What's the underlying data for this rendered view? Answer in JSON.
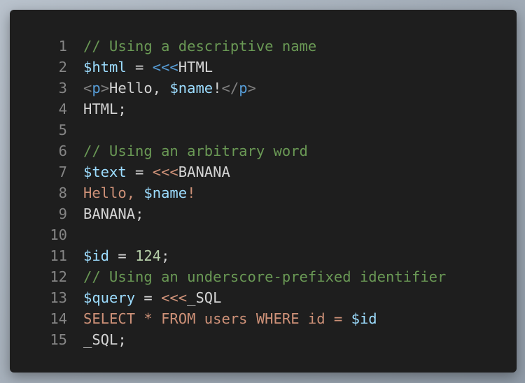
{
  "code": {
    "lines": [
      {
        "number": "1",
        "tokens": [
          {
            "text": "// Using a descriptive name",
            "type": "cm"
          }
        ]
      },
      {
        "number": "2",
        "tokens": [
          {
            "text": "$html",
            "type": "va"
          },
          {
            "text": " = ",
            "type": "op"
          },
          {
            "text": "<<<",
            "type": "hd"
          },
          {
            "text": "HTML",
            "type": "tx"
          }
        ]
      },
      {
        "number": "3",
        "tokens": [
          {
            "text": "<",
            "type": "tg"
          },
          {
            "text": "p",
            "type": "tn"
          },
          {
            "text": ">",
            "type": "tg"
          },
          {
            "text": "Hello, ",
            "type": "tx"
          },
          {
            "text": "$name",
            "type": "va"
          },
          {
            "text": "!",
            "type": "tx"
          },
          {
            "text": "</",
            "type": "tg"
          },
          {
            "text": "p",
            "type": "tn"
          },
          {
            "text": ">",
            "type": "tg"
          }
        ]
      },
      {
        "number": "4",
        "tokens": [
          {
            "text": "HTML",
            "type": "tx"
          },
          {
            "text": ";",
            "type": "pn"
          }
        ]
      },
      {
        "number": "5",
        "tokens": []
      },
      {
        "number": "6",
        "tokens": [
          {
            "text": "// Using an arbitrary word",
            "type": "cm"
          }
        ]
      },
      {
        "number": "7",
        "tokens": [
          {
            "text": "$text",
            "type": "va"
          },
          {
            "text": " = ",
            "type": "op"
          },
          {
            "text": "<<<",
            "type": "hs"
          },
          {
            "text": "BANANA",
            "type": "tx"
          }
        ]
      },
      {
        "number": "8",
        "tokens": [
          {
            "text": "Hello, ",
            "type": "st"
          },
          {
            "text": "$name",
            "type": "va"
          },
          {
            "text": "!",
            "type": "st"
          }
        ]
      },
      {
        "number": "9",
        "tokens": [
          {
            "text": "BANANA",
            "type": "tx"
          },
          {
            "text": ";",
            "type": "pn"
          }
        ]
      },
      {
        "number": "10",
        "tokens": []
      },
      {
        "number": "11",
        "tokens": [
          {
            "text": "$id",
            "type": "va"
          },
          {
            "text": " = ",
            "type": "op"
          },
          {
            "text": "124",
            "type": "nu"
          },
          {
            "text": ";",
            "type": "pn"
          }
        ]
      },
      {
        "number": "12",
        "tokens": [
          {
            "text": "// Using an underscore-prefixed identifier",
            "type": "cm"
          }
        ]
      },
      {
        "number": "13",
        "tokens": [
          {
            "text": "$query",
            "type": "va"
          },
          {
            "text": " = ",
            "type": "op"
          },
          {
            "text": "<<<",
            "type": "hs"
          },
          {
            "text": "_SQL",
            "type": "tx"
          }
        ]
      },
      {
        "number": "14",
        "tokens": [
          {
            "text": "SELECT * FROM users WHERE id = ",
            "type": "st"
          },
          {
            "text": "$id",
            "type": "va"
          }
        ]
      },
      {
        "number": "15",
        "tokens": [
          {
            "text": "_SQL",
            "type": "tx"
          },
          {
            "text": ";",
            "type": "pn"
          }
        ]
      }
    ]
  },
  "colors": {
    "background": "#1e1e1e",
    "line_number": "#858585",
    "comment": "#6a9955",
    "variable": "#9cdcfe",
    "keyword": "#569cd6",
    "string": "#ce9178",
    "number": "#b5cea8",
    "text": "#d4d4d4"
  }
}
